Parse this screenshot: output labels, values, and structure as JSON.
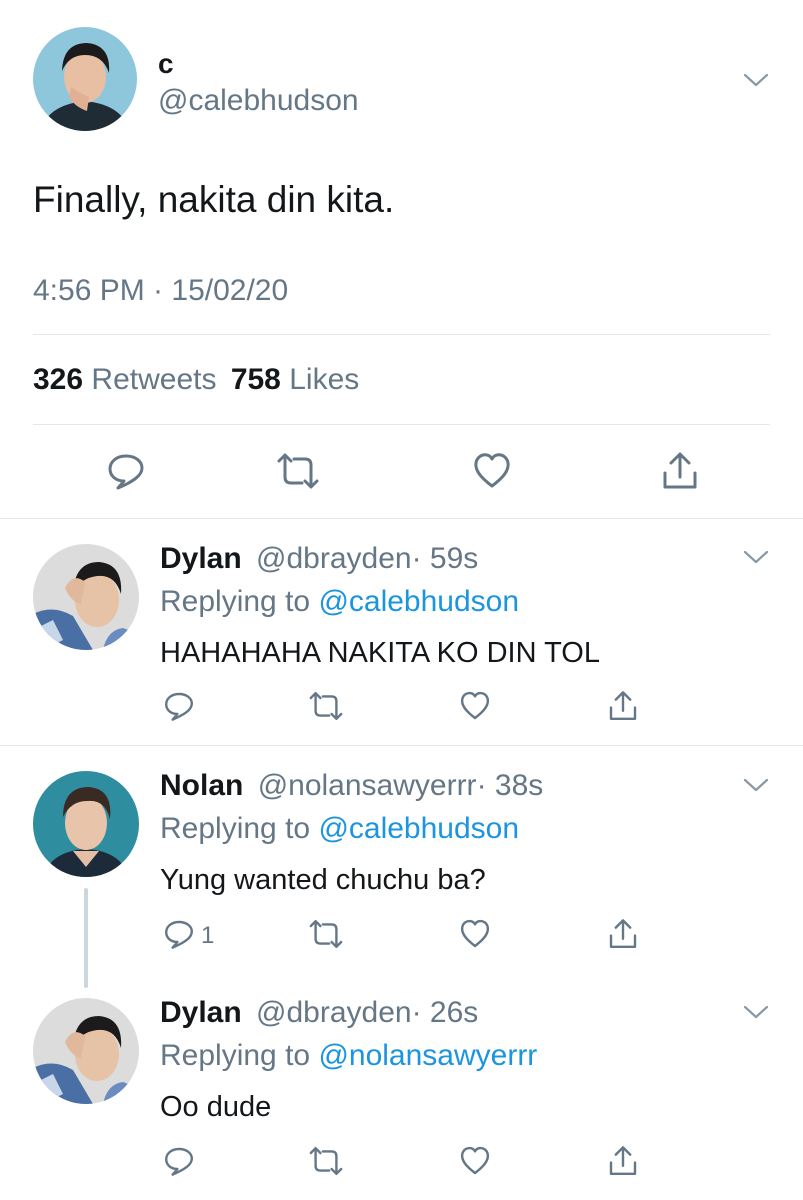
{
  "main_tweet": {
    "name": "c",
    "handle": "@calebhudson",
    "text": "Finally, nakita din kita.",
    "timestamp": "4:56 PM · 15/02/20",
    "retweets_count": "326",
    "retweets_label": "Retweets",
    "likes_count": "758",
    "likes_label": "Likes"
  },
  "replies": [
    {
      "name": "Dylan",
      "handle": "@dbrayden",
      "time": "· 59s",
      "replying_prefix": "Replying to",
      "replying_to": "@calebhudson",
      "text": "HAHAHAHA NAKITA KO DIN TOL",
      "reply_count": ""
    },
    {
      "name": "Nolan",
      "handle": "@nolansawyerrr",
      "time": "· 38s",
      "replying_prefix": "Replying to",
      "replying_to": "@calebhudson",
      "text": "Yung wanted chuchu ba?",
      "reply_count": "1"
    },
    {
      "name": "Dylan",
      "handle": "@dbrayden",
      "time": "· 26s",
      "replying_prefix": "Replying to",
      "replying_to": "@nolansawyerrr",
      "text": "Oo dude",
      "reply_count": ""
    }
  ],
  "colors": {
    "text": "#14171a",
    "muted": "#657786",
    "link": "#1b95e0",
    "divider": "#e1e8ed",
    "thread_line": "#ccd6dd"
  },
  "icons": [
    "chevron-down-icon",
    "reply-icon",
    "retweet-icon",
    "like-icon",
    "share-icon"
  ]
}
